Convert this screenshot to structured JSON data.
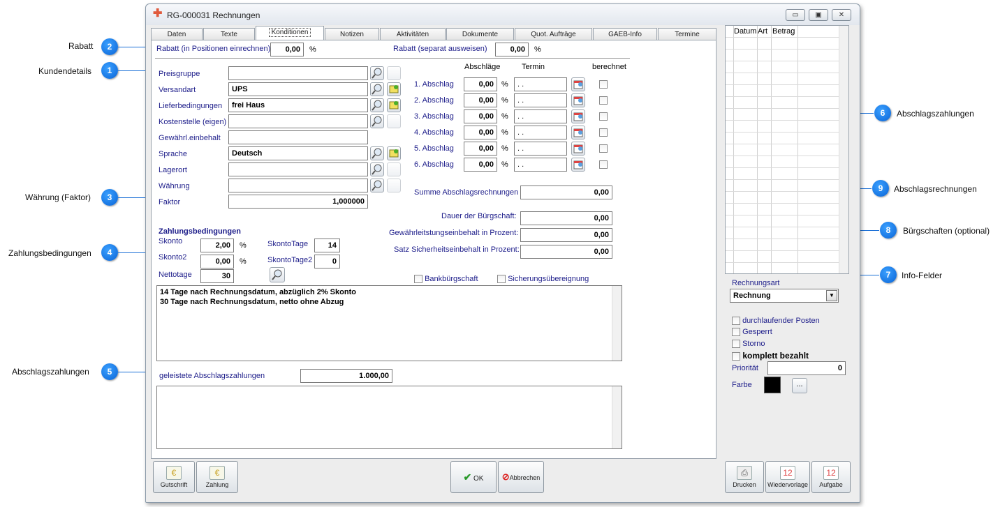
{
  "window": {
    "title": "RG-000031 Rechnungen"
  },
  "tabs": [
    "Daten",
    "Texte",
    "Konditionen",
    "Notizen",
    "Aktivitäten",
    "Dokumente",
    "Quot. Aufträge",
    "GAEB-Info",
    "Termine"
  ],
  "rabatt": {
    "pos_label": "Rabatt (in Positionen einrechnen)",
    "pos_value": "0,00",
    "pos_unit": "%",
    "sep_label": "Rabatt (separat ausweisen)",
    "sep_value": "0,00",
    "sep_unit": "%"
  },
  "kunde": {
    "preisgruppe": {
      "label": "Preisgruppe",
      "value": ""
    },
    "versandart": {
      "label": "Versandart",
      "value": "UPS"
    },
    "lieferbedingungen": {
      "label": "Lieferbedingungen",
      "value": "frei Haus"
    },
    "kostenstelle": {
      "label": "Kostenstelle (eigen)",
      "value": ""
    },
    "gewaehr": {
      "label": "Gewährl.einbehalt",
      "value": ""
    },
    "sprache": {
      "label": "Sprache",
      "value": "Deutsch"
    },
    "lagerort": {
      "label": "Lagerort",
      "value": ""
    },
    "waehrung": {
      "label": "Währung",
      "value": ""
    },
    "faktor": {
      "label": "Faktor",
      "value": "1,000000"
    }
  },
  "abschlag": {
    "header_abschlaege": "Abschläge",
    "header_termin": "Termin",
    "header_berechnet": "berechnet",
    "rows": [
      {
        "label": "1. Abschlag",
        "value": "0,00",
        "unit": "%",
        "termin": ". ."
      },
      {
        "label": "2. Abschlag",
        "value": "0,00",
        "unit": "%",
        "termin": ". ."
      },
      {
        "label": "3. Abschlag",
        "value": "0,00",
        "unit": "%",
        "termin": ". ."
      },
      {
        "label": "4. Abschlag",
        "value": "0,00",
        "unit": "%",
        "termin": ". ."
      },
      {
        "label": "5. Abschlag",
        "value": "0,00",
        "unit": "%",
        "termin": ". ."
      },
      {
        "label": "6. Abschlag",
        "value": "0,00",
        "unit": "%",
        "termin": ". ."
      }
    ],
    "summe_label": "Summe Abschlagsrechnungen",
    "summe_value": "0,00"
  },
  "buergschaft": {
    "dauer_label": "Dauer der Bürgschaft:",
    "dauer_value": "0,00",
    "gew_label": "Gewährleitstungseinbehalt in Prozent:",
    "gew_value": "0,00",
    "satz_label": "Satz Sicherheitseinbehalt in Prozent:",
    "satz_value": "0,00"
  },
  "zahlung": {
    "title": "Zahlungsbedingungen",
    "skonto_label": "Skonto",
    "skonto_value": "2,00",
    "skonto_unit": "%",
    "skonto2_label": "Skonto2",
    "skonto2_value": "0,00",
    "skonto2_unit": "%",
    "tage_label": "SkontoTage",
    "tage_value": "14",
    "tage2_label": "SkontoTage2",
    "tage2_value": "0",
    "netto_label": "Nettotage",
    "netto_value": "30",
    "text_line1": "14 Tage nach Rechnungsdatum, abzüglich 2% Skonto",
    "text_line2": "30 Tage nach Rechnungsdatum, netto ohne Abzug"
  },
  "info": {
    "bank": "Bankbürgschaft",
    "sicherung": "Sicherungsübereignung"
  },
  "geleistet": {
    "label": "geleistete Abschlagszahlungen",
    "value": "1.000,00"
  },
  "sidebar": {
    "columns": [
      "Datum",
      "Art",
      "Betrag"
    ],
    "rechnungsart_label": "Rechnungsart",
    "rechnungsart_value": "Rechnung",
    "durchlaufend": "durchlaufender Posten",
    "gesperrt": "Gesperrt",
    "storno": "Storno",
    "komplett": "komplett bezahlt",
    "prioritaet_label": "Priorität",
    "prioritaet_value": "0",
    "farbe_label": "Farbe",
    "farbe_btn": "...",
    "farbe_color": "#000000"
  },
  "buttons": {
    "gutschrift": "Gutschrift",
    "zahlung": "Zahlung",
    "ok": "OK",
    "abbrechen": "Abbrechen",
    "drucken": "Drucken",
    "wiedervorlage": "Wiedervorlage",
    "aufgabe": "Aufgabe"
  },
  "callouts": [
    {
      "num": "2",
      "text": "Rabatt"
    },
    {
      "num": "1",
      "text": "Kundendetails"
    },
    {
      "num": "3",
      "text": "Währung (Faktor)"
    },
    {
      "num": "4",
      "text": "Zahlungsbedingungen"
    },
    {
      "num": "5",
      "text": "Abschlagszahlungen"
    },
    {
      "num": "6",
      "text": "Abschlagszahlungen"
    },
    {
      "num": "9",
      "text": "Abschlagsrechnungen"
    },
    {
      "num": "8",
      "text": "Bürgschaften (optional)"
    },
    {
      "num": "7",
      "text": "Info-Felder"
    }
  ],
  "colors": {
    "accent": "#1a6fd6",
    "label": "#1d1d8a"
  }
}
